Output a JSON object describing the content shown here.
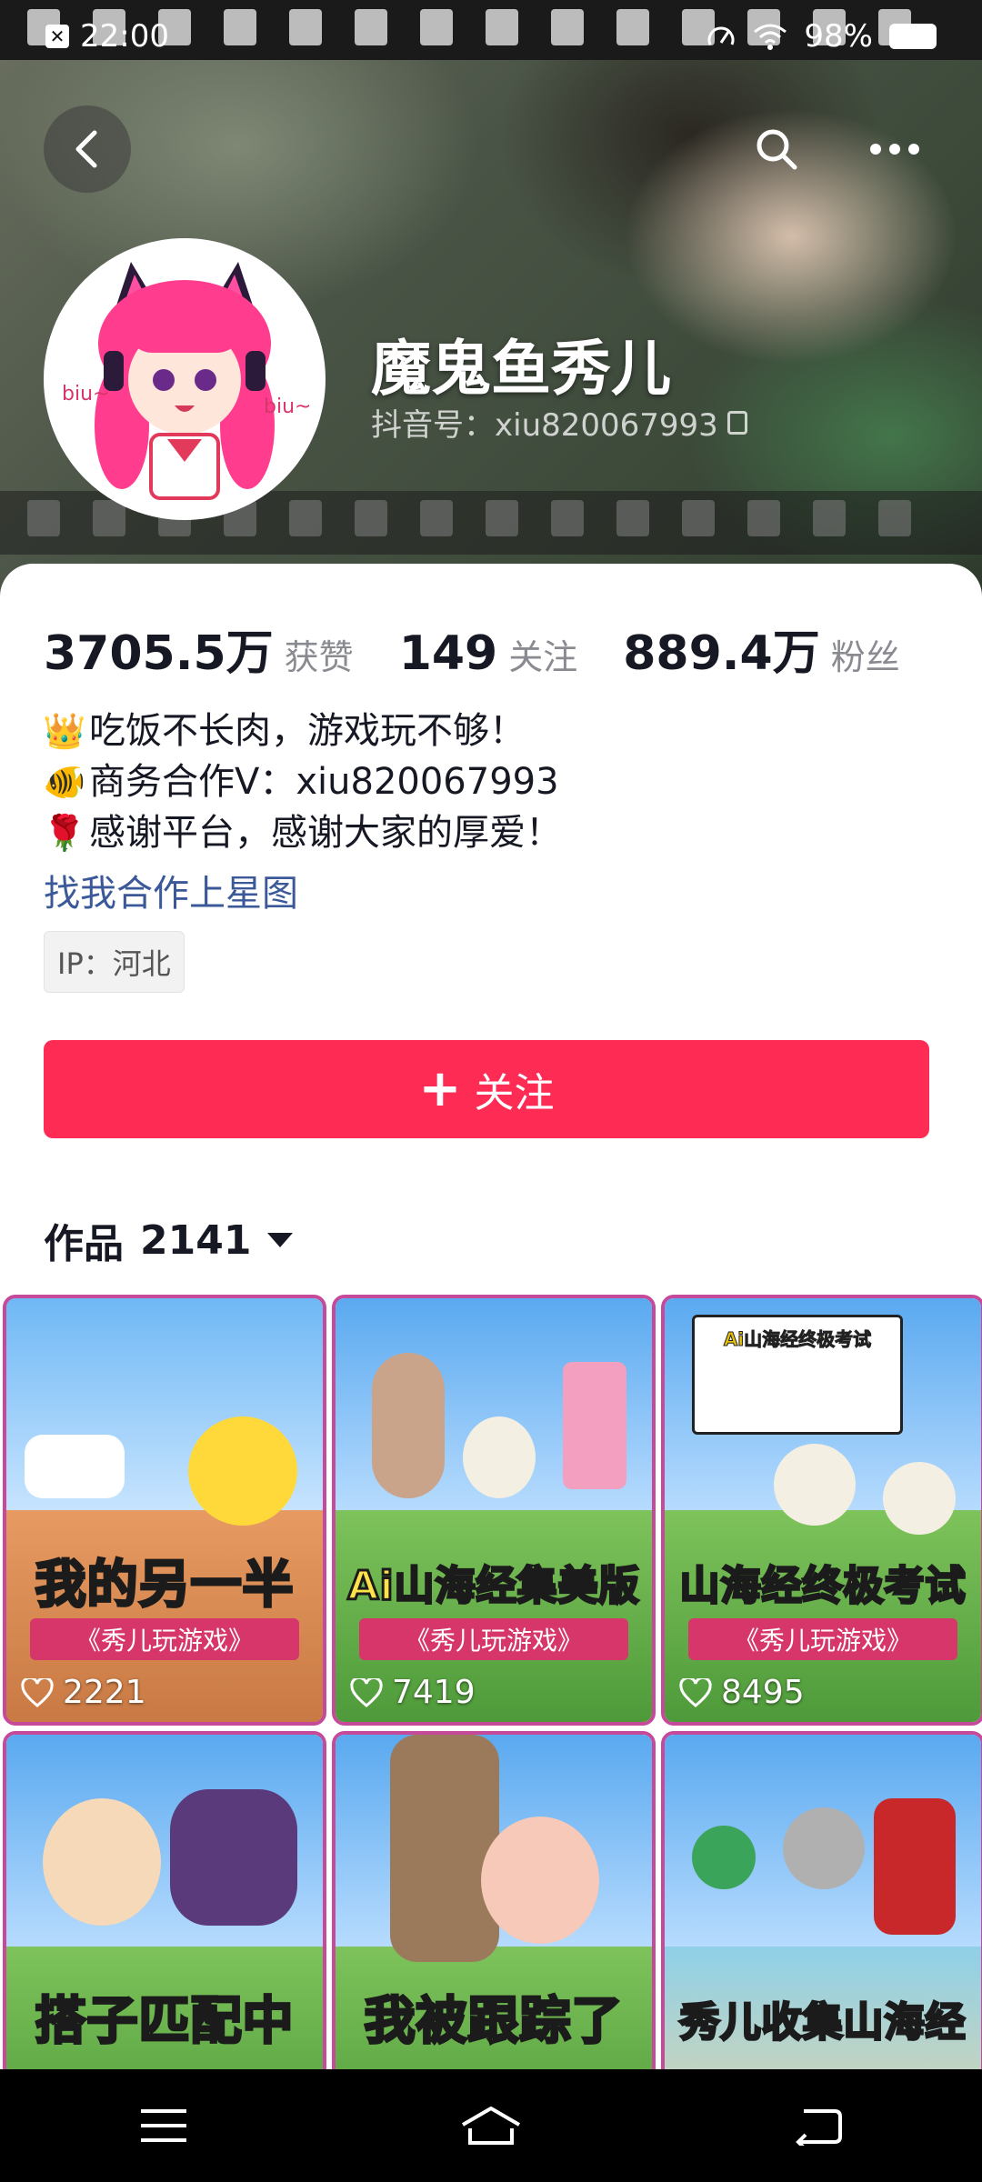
{
  "status_bar": {
    "time": "22:00",
    "battery": "98%"
  },
  "profile": {
    "nickname": "魔鬼鱼秀儿",
    "douyin_id": "抖音号：xiu820067993",
    "avatar_text_left": "biu~",
    "avatar_text_right": "biu~"
  },
  "stats": [
    {
      "value": "3705.5万",
      "label": "获赞"
    },
    {
      "value": "149",
      "label": "关注"
    },
    {
      "value": "889.4万",
      "label": "粉丝"
    }
  ],
  "bio": [
    {
      "icon": "crown-icon",
      "glyph": "👑",
      "text": "吃饭不长肉，游戏玩不够！"
    },
    {
      "icon": "fish-icon",
      "glyph": "🐠",
      "text": "商务合作V：xiu820067993"
    },
    {
      "icon": "rose-icon",
      "glyph": "🌹",
      "text": "感谢平台，感谢大家的厚爱！"
    }
  ],
  "star_link": "找我合作上星图",
  "ip": "IP：河北",
  "follow_button": "关注",
  "works": {
    "label": "作品",
    "count": "2141"
  },
  "videos": [
    {
      "caption": "我的另一半",
      "subtitle": "《秀儿玩游戏》",
      "likes": "2221"
    },
    {
      "caption": "Ai山海经集美版",
      "subtitle": "《秀儿玩游戏》",
      "likes": "7419"
    },
    {
      "caption": "山海经终极考试",
      "subtitle": "《秀儿玩游戏》",
      "likes": "8495",
      "inset_title": "Ai山海经终极考试"
    },
    {
      "caption": "搭子匹配中"
    },
    {
      "caption": "我被跟踪了"
    },
    {
      "caption": "秀儿收集山海经"
    }
  ],
  "colors": {
    "accent": "#fe2c55",
    "link": "#3b5998",
    "caption_yellow": "#ffe14a",
    "subtitle_bg": "#d6366a",
    "tile_border": "#c54a9a"
  }
}
